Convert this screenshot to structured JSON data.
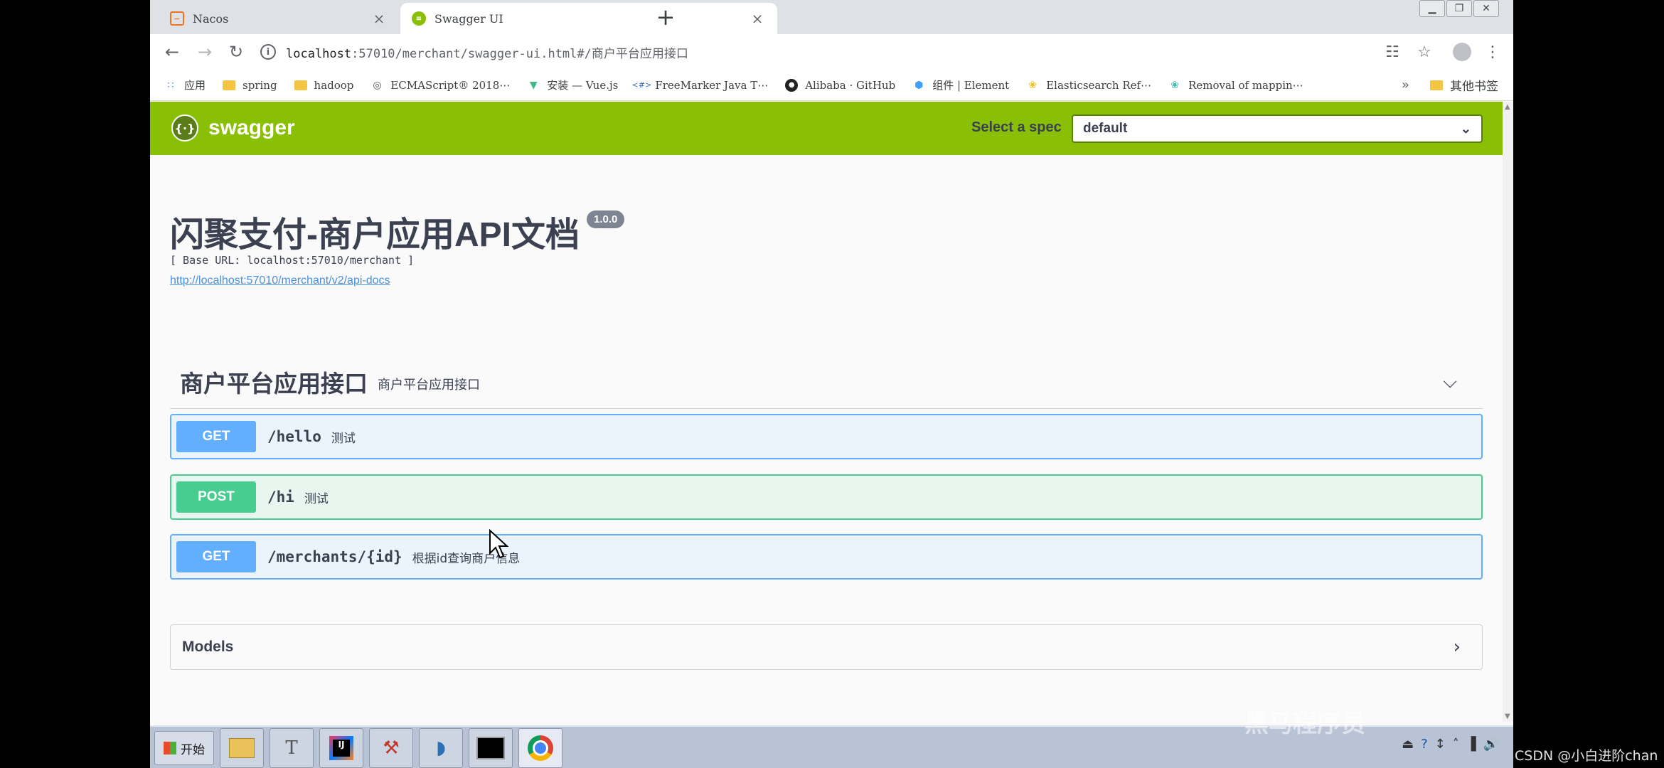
{
  "tabs": [
    {
      "title": "Nacos",
      "icon": "nacos-icon"
    },
    {
      "title": "Swagger UI",
      "icon": "swagger-favicon-icon"
    }
  ],
  "toolbar": {
    "url_host": "localhost",
    "url_rest": ":57010/merchant/swagger-ui.html#/商户平台应用接口"
  },
  "bookmarks": [
    {
      "label": "应用",
      "kind": "apps"
    },
    {
      "label": "spring",
      "kind": "folder"
    },
    {
      "label": "hadoop",
      "kind": "folder"
    },
    {
      "label": "ECMAScript® 2018⋯",
      "kind": "globe"
    },
    {
      "label": "安装 — Vue.js",
      "kind": "vue"
    },
    {
      "label": "FreeMarker Java T⋯",
      "kind": "fm"
    },
    {
      "label": "Alibaba · GitHub",
      "kind": "github"
    },
    {
      "label": "组件 | Element",
      "kind": "element"
    },
    {
      "label": "Elasticsearch Ref⋯",
      "kind": "elastic"
    },
    {
      "label": "Removal of mappin⋯",
      "kind": "elastic"
    }
  ],
  "bookmarks_other": "其他书签",
  "swagger": {
    "logo_text": "swagger",
    "spec_label": "Select a spec",
    "spec_value": "default",
    "title": "闪聚支付-商户应用API文档",
    "version": "1.0.0",
    "base_url": "[ Base URL: localhost:57010/merchant ]",
    "docs_link": "http://localhost:57010/merchant/v2/api-docs",
    "tag": {
      "name": "商户平台应用接口",
      "description": "商户平台应用接口"
    },
    "operations": [
      {
        "method": "GET",
        "path": "/hello",
        "summary": "测试"
      },
      {
        "method": "POST",
        "path": "/hi",
        "summary": "测试"
      },
      {
        "method": "GET",
        "path": "/merchants/{id}",
        "summary": "根据id查询商户信息"
      }
    ],
    "models_label": "Models"
  },
  "taskbar": {
    "start_label": "开始"
  },
  "watermark": "黑马程序员",
  "credit": "CSDN @小白进阶chan",
  "colors": {
    "swagger_green": "#89bf04",
    "get_blue": "#61affe",
    "post_green": "#49cc90"
  }
}
